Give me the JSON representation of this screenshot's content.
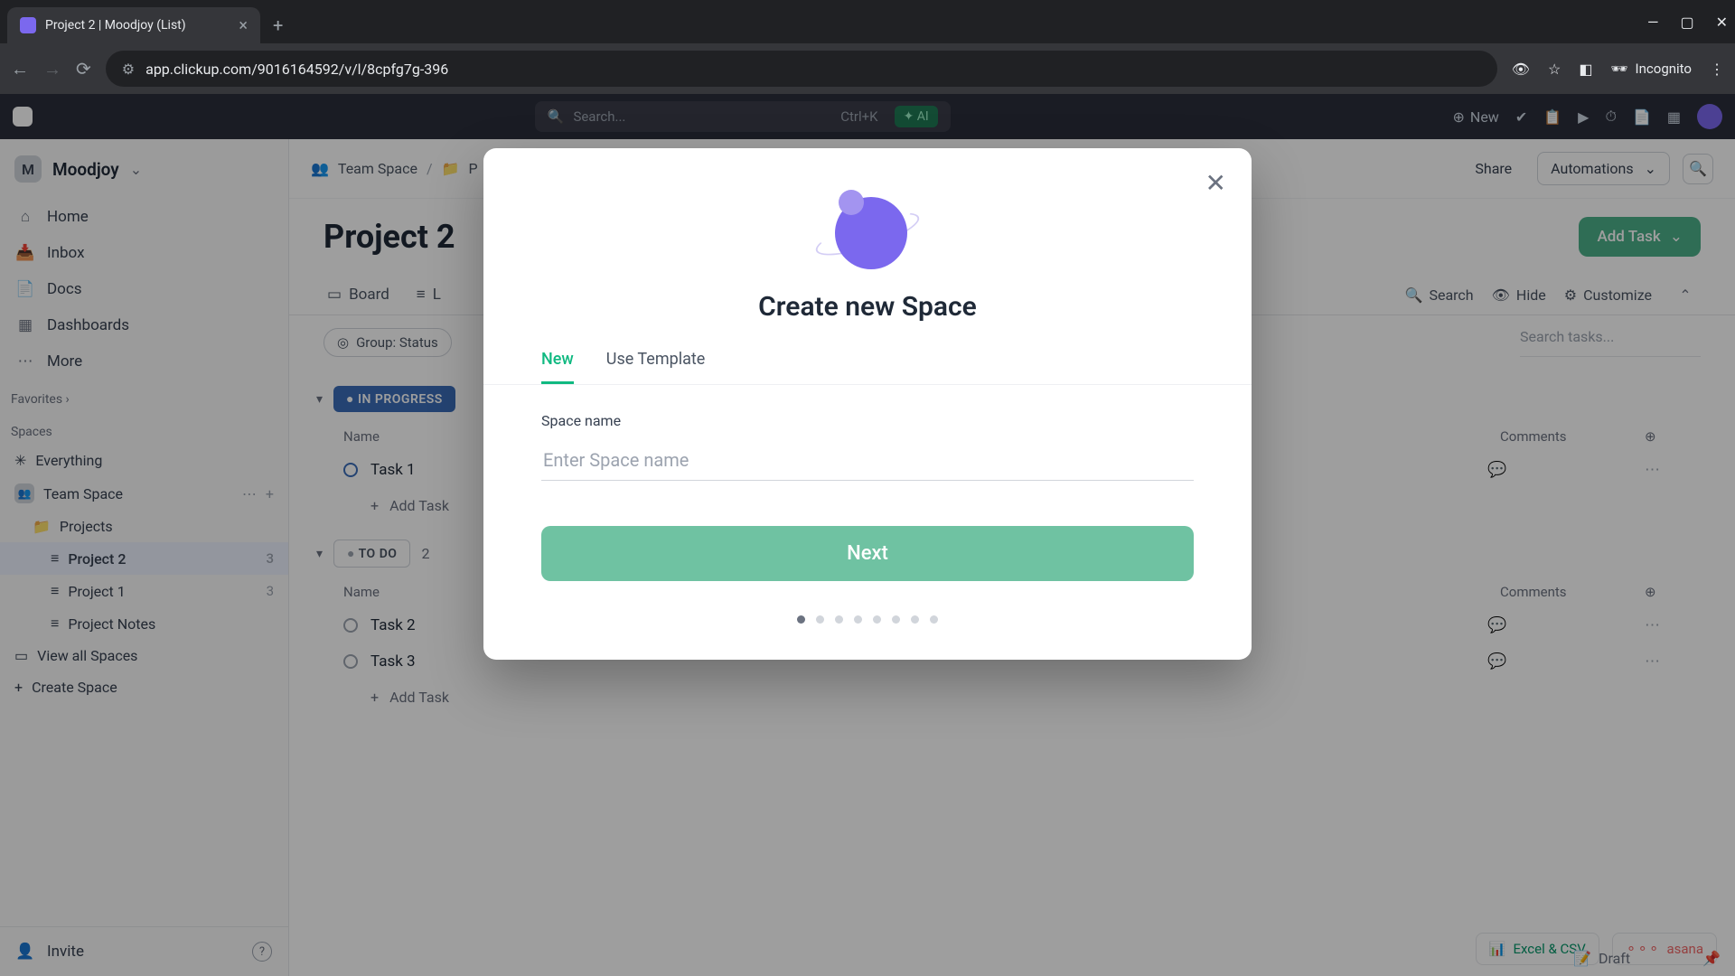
{
  "browser": {
    "tab_title": "Project 2 | Moodjoy (List)",
    "url": "app.clickup.com/9016164592/v/l/8cpfg7g-396",
    "incognito": "Incognito"
  },
  "topbar": {
    "search_placeholder": "Search...",
    "shortcut": "Ctrl+K",
    "ai_label": "AI",
    "new_label": "New"
  },
  "workspace": {
    "initial": "M",
    "name": "Moodjoy"
  },
  "sidebar_nav": [
    {
      "label": "Home"
    },
    {
      "label": "Inbox"
    },
    {
      "label": "Docs"
    },
    {
      "label": "Dashboards"
    },
    {
      "label": "More"
    }
  ],
  "sidebar_sections": {
    "favorites": "Favorites",
    "spaces": "Spaces"
  },
  "space_tree": {
    "everything": "Everything",
    "team_space": "Team Space",
    "projects": "Projects",
    "project2": {
      "label": "Project 2",
      "count": "3"
    },
    "project1": {
      "label": "Project 1",
      "count": "3"
    },
    "project_notes": "Project Notes",
    "view_all": "View all Spaces",
    "create_space": "Create Space"
  },
  "sidebar_footer": {
    "invite": "Invite"
  },
  "breadcrumb": {
    "space": "Team Space",
    "folder": "P"
  },
  "header_actions": {
    "share": "Share",
    "automations": "Automations"
  },
  "page": {
    "title": "Project 2",
    "add_task": "Add Task"
  },
  "view_tabs": {
    "board": "Board",
    "list": "L"
  },
  "view_actions": {
    "search": "Search",
    "hide": "Hide",
    "customize": "Customize"
  },
  "filters": {
    "group": "Group: Status"
  },
  "search_tasks_placeholder": "Search tasks...",
  "groups": {
    "in_progress": {
      "label": "IN PROGRESS",
      "columns": {
        "name": "Name",
        "comments": "Comments"
      },
      "tasks": [
        "Task 1"
      ],
      "add": "Add Task"
    },
    "todo": {
      "label": "TO DO",
      "count": "2",
      "columns": {
        "name": "Name",
        "comments": "Comments"
      },
      "tasks": [
        "Task 2",
        "Task 3"
      ],
      "add": "Add Task"
    }
  },
  "corner": {
    "excel": "Excel & CSV",
    "asana": "asana",
    "draft": "Draft"
  },
  "modal": {
    "title": "Create new Space",
    "tabs": {
      "new": "New",
      "template": "Use Template"
    },
    "label": "Space name",
    "placeholder": "Enter Space name",
    "next": "Next",
    "steps": 8
  }
}
